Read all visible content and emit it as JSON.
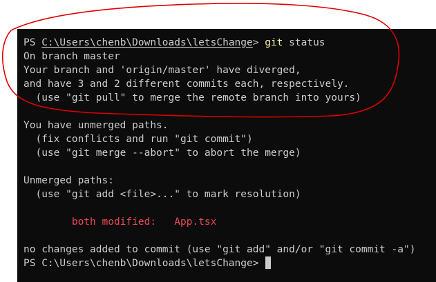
{
  "terminal": {
    "prompt_ps": "PS ",
    "path": "C:\\Users\\chenb\\Downloads\\letsChange",
    "prompt_gt": "> ",
    "cmd_git": "git",
    "cmd_args": " status",
    "lines": {
      "on_branch": "On branch master",
      "diverged": "Your branch and 'origin/master' have diverged,",
      "commits": "and have 3 and 2 different commits each, respectively.",
      "pull_hint": "  (use \"git pull\" to merge the remote branch into yours)",
      "unmerged_heading": "You have unmerged paths.",
      "fix_hint": "  (fix conflicts and run \"git commit\")",
      "abort_hint": "  (use \"git merge --abort\" to abort the merge)",
      "unmerged_paths": "Unmerged paths:",
      "add_hint": "  (use \"git add <file>...\" to mark resolution)",
      "both_modified": "        both modified:   App.tsx",
      "no_changes": "no changes added to commit (use \"git add\" and/or \"git commit -a\")",
      "final_prompt": "PS C:\\Users\\chenb\\Downloads\\letsChange> "
    }
  },
  "colors": {
    "background": "#0c0c0c",
    "foreground": "#cccccc",
    "command": "#f9f1a5",
    "conflict": "#e74856",
    "annotation": "#e00000"
  }
}
